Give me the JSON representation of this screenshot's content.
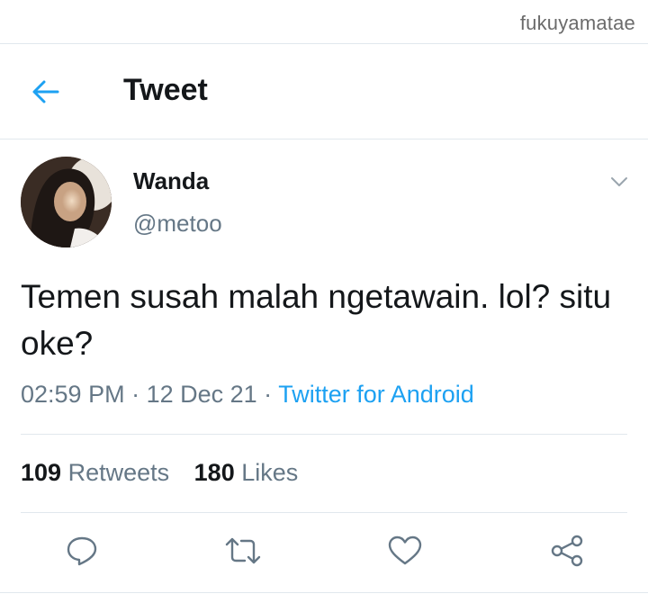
{
  "watermark": "fukuyamatae",
  "header": {
    "back_icon": "arrow-left-icon",
    "title": "Tweet"
  },
  "tweet": {
    "author": {
      "display_name": "Wanda",
      "handle": "@metoo",
      "avatar": "profile-photo"
    },
    "menu_icon": "chevron-down-icon",
    "text": "Temen susah malah ngetawain. lol? situ oke?",
    "time": "02:59 PM",
    "date": "12 Dec 21",
    "separator": " · ",
    "source": "Twitter for Android",
    "stats": {
      "retweets_count": "109",
      "retweets_label": "Retweets",
      "likes_count": "180",
      "likes_label": "Likes"
    },
    "actions": [
      {
        "name": "reply",
        "icon": "reply-icon"
      },
      {
        "name": "retweet",
        "icon": "retweet-icon"
      },
      {
        "name": "like",
        "icon": "heart-icon"
      },
      {
        "name": "share",
        "icon": "share-icon"
      }
    ]
  },
  "colors": {
    "accent": "#1da1f2",
    "text_primary": "#14171a",
    "text_secondary": "#657786",
    "divider": "#e1e8ed"
  }
}
